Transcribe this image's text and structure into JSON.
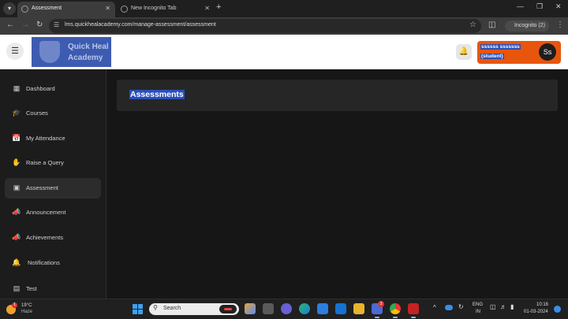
{
  "browser": {
    "tabs": [
      {
        "title": "Assessment",
        "active": true
      },
      {
        "title": "New Incognito Tab",
        "active": false
      }
    ],
    "url": "lms.quickhealacademy.com/manage-assessment/assessment",
    "profile_label": "Incognito (2)"
  },
  "header": {
    "logo_line1": "Quick Heal",
    "logo_line2": "Academy",
    "user_name": "ssssss sssssss",
    "user_role": "(student)",
    "avatar_initials": "Ss"
  },
  "sidebar": {
    "items": [
      {
        "label": "Dashboard",
        "icon": "dashboard-icon"
      },
      {
        "label": "Courses",
        "icon": "courses-icon"
      },
      {
        "label": "My Attendance",
        "icon": "calendar-icon"
      },
      {
        "label": "Raise a Query",
        "icon": "hand-icon"
      },
      {
        "label": "Assessment",
        "icon": "assessment-icon",
        "active": true
      },
      {
        "label": "Announcement",
        "icon": "megaphone-icon"
      },
      {
        "label": "Achievements",
        "icon": "megaphone-icon"
      },
      {
        "label": "Notifications",
        "icon": "bell-icon"
      },
      {
        "label": "Test",
        "icon": "test-icon"
      }
    ]
  },
  "main": {
    "title": "Assessments"
  },
  "taskbar": {
    "weather_temp": "19°C",
    "weather_desc": "Haze",
    "search_placeholder": "Search",
    "lang_line1": "ENG",
    "lang_line2": "IN",
    "time": "10:16",
    "date": "01-03-2024",
    "teams_badge": "3",
    "weather_badge": "1"
  },
  "colors": {
    "accent_orange": "#e8550d",
    "selection_blue": "#2a4fb8",
    "logo_blue": "#3d5bb0"
  }
}
